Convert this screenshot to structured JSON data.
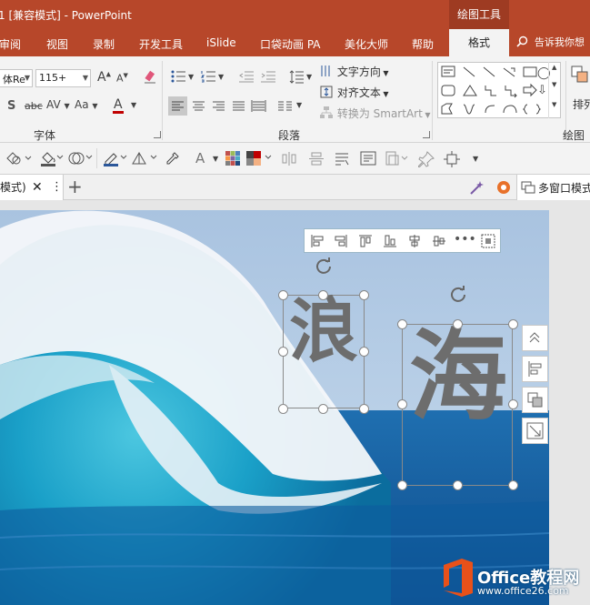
{
  "titlebar": {
    "title": "1 [兼容模式] - PowerPoint",
    "contextual_group": "绘图工具"
  },
  "tabs": [
    "审阅",
    "视图",
    "录制",
    "开发工具",
    "iSlide",
    "口袋动画 PA",
    "美化大师",
    "帮助"
  ],
  "active_tab": "格式",
  "tell_me": "告诉我你想",
  "font_group": {
    "font_name": "体Re",
    "font_size": "115+",
    "label": "字体",
    "char_spacing_label": "AV",
    "case_label": "Aa",
    "increase_font": "A",
    "decrease_font": "A",
    "font_color_letter": "A",
    "shadow_letter": "S",
    "strike_label": "abc",
    "font_color": "#c00000"
  },
  "paragraph_group": {
    "label": "段落",
    "text_direction": "文字方向",
    "align_text": "对齐文本",
    "convert_smartart": "转换为 SmartArt"
  },
  "drawing_group": {
    "label": "绘图",
    "arrange": "排列"
  },
  "doc_tab": {
    "label": "模式)"
  },
  "multiwindow": "多窗口模式",
  "slide": {
    "char1": "浪",
    "char2": "海"
  },
  "watermark": {
    "name": "Office教程网",
    "url": "www.office26.com"
  },
  "colors": {
    "accent": "#b7472a",
    "context": "#9e3b22",
    "text_fill": "#6d6d6d",
    "brand": "#e8511a"
  }
}
